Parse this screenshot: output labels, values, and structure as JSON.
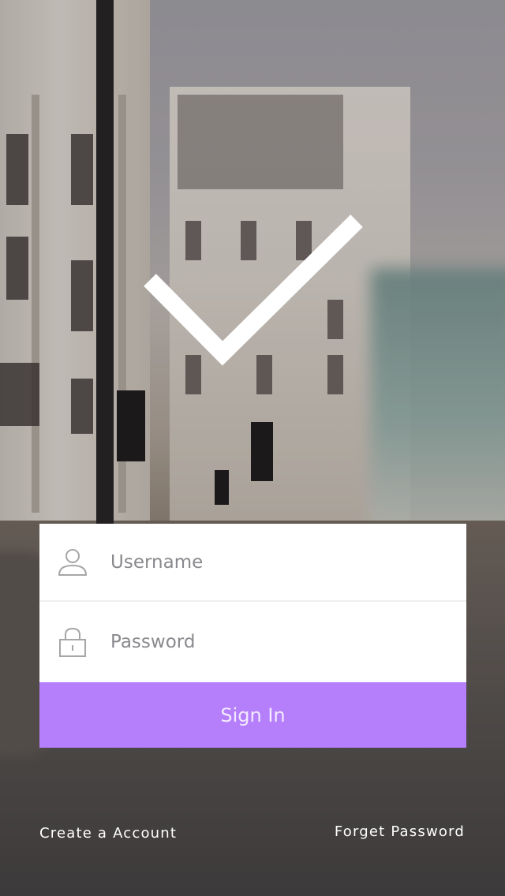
{
  "form": {
    "username_placeholder": "Username",
    "password_placeholder": "Password",
    "signin_label": "Sign In"
  },
  "footer": {
    "create_account": "Create a Account",
    "forget_password": "Forget Password"
  },
  "icons": {
    "logo": "checkmark-icon",
    "username": "user-icon",
    "password": "lock-icon"
  },
  "colors": {
    "accent": "#b57ffb",
    "card": "#ffffff",
    "link_text": "#ffffff"
  }
}
